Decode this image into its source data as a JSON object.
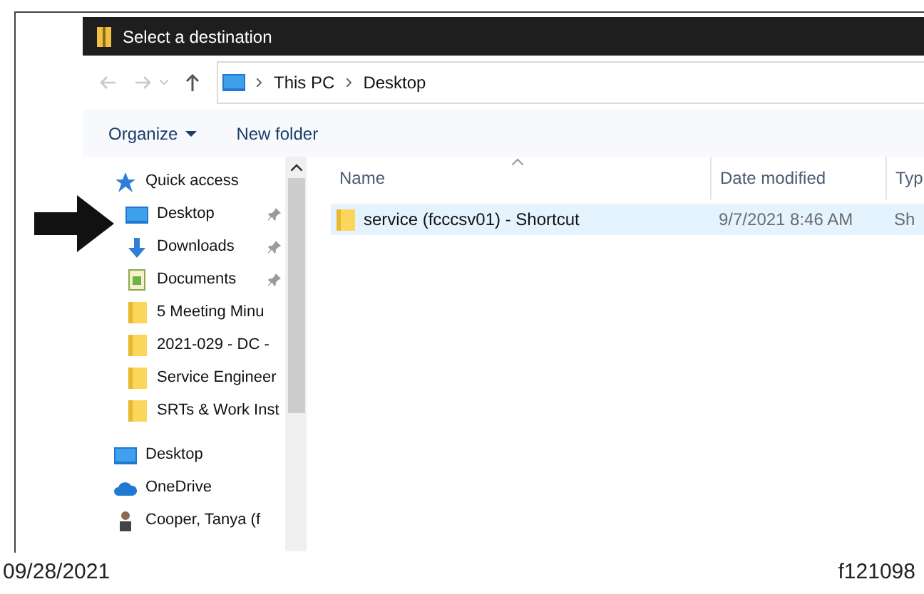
{
  "window": {
    "title": "Select a destination"
  },
  "breadcrumb": [
    "This PC",
    "Desktop"
  ],
  "toolbar": [
    {
      "label": "Organize",
      "dropdown": true
    },
    {
      "label": "New folder",
      "dropdown": false
    }
  ],
  "sidebar": {
    "items": [
      {
        "label": "Quick access",
        "kind": "star",
        "pinned": false,
        "children": [
          {
            "label": "Desktop",
            "kind": "desktop",
            "pinned": true
          },
          {
            "label": "Downloads",
            "kind": "download",
            "pinned": true
          },
          {
            "label": "Documents",
            "kind": "document",
            "pinned": true
          },
          {
            "label": "5  Meeting Minu",
            "kind": "folder",
            "pinned": false
          },
          {
            "label": "2021-029 - DC -",
            "kind": "folder",
            "pinned": false
          },
          {
            "label": "Service Engineer",
            "kind": "folder",
            "pinned": false
          },
          {
            "label": "SRTs & Work Inst",
            "kind": "folder",
            "pinned": false
          }
        ]
      },
      {
        "label": "Desktop",
        "kind": "desktop",
        "pinned": false
      },
      {
        "label": "OneDrive",
        "kind": "cloud",
        "pinned": false
      },
      {
        "label": "Cooper, Tanya (f",
        "kind": "user",
        "pinned": false
      }
    ]
  },
  "table": {
    "columns": [
      "Name",
      "Date modified",
      "Typ"
    ],
    "rows": [
      {
        "name": "service (fcccsv01) - Shortcut",
        "date": "9/7/2021 8:46 AM",
        "type": "Sh",
        "selected": true
      }
    ]
  },
  "footer": {
    "date": "09/28/2021",
    "figure": "f121098"
  }
}
